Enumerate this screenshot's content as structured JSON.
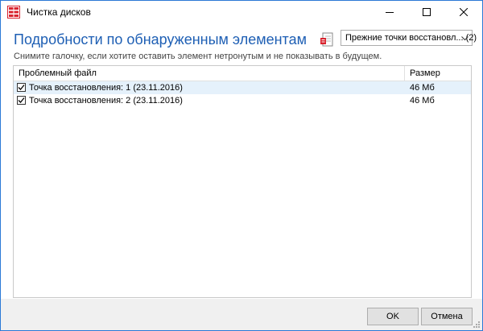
{
  "window": {
    "title": "Чистка дисков"
  },
  "header": {
    "heading": "Подробности по обнаруженным элементам",
    "instruction": "Снимите галочку, если хотите оставить элемент нетронутым и не показывать в будущем."
  },
  "category": {
    "selected": "Прежние точки восстановл... (2)",
    "icon": "restore-point-icon"
  },
  "table": {
    "columns": [
      "Проблемный файл",
      "Размер"
    ],
    "rows": [
      {
        "name": "Точка восстановления: 1 (23.11.2016)",
        "size": "46 Мб",
        "checked": true
      },
      {
        "name": "Точка восстановления: 2 (23.11.2016)",
        "size": "46 Мб",
        "checked": true
      }
    ]
  },
  "buttons": {
    "ok": "OK",
    "cancel": "Отмена"
  },
  "colors": {
    "heading": "#1e5fb4",
    "selected_row": "#e5f1fb",
    "accent_icon": "#d9232e"
  }
}
